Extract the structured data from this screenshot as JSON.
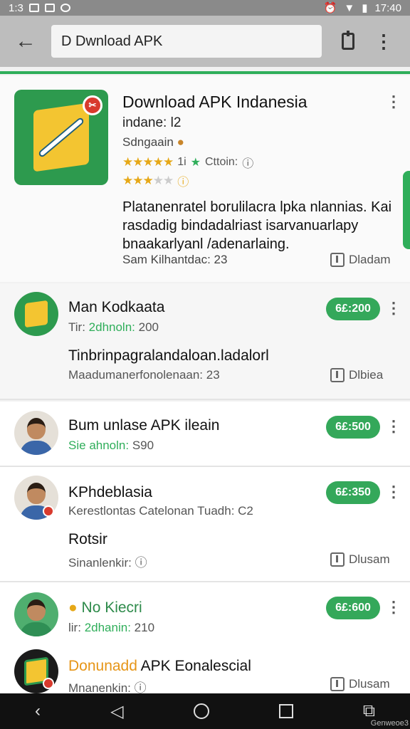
{
  "status_bar": {
    "time_left": "1:3",
    "time_right": "17:40"
  },
  "search": {
    "value": "D Dwnload APK"
  },
  "main_card": {
    "title": "Download APK Indanesia",
    "subtitle": "indane: l2",
    "developer": "Sdngaain",
    "rating_note": "1i",
    "rating_label": "Cttoin:",
    "description": "Platanenratel borulilacra lpka nlannias. Kai rasdadig bindadalriast isarvanuarlapy bnaakarlyanl /adenarlaing.",
    "footer_meta": "Sam Kilhantdac: 23",
    "download_label": "Dladam"
  },
  "items": [
    {
      "title": "Man Kodkaata",
      "sub_prefix": "Tir:",
      "sub_green": "2dhnoln:",
      "sub_value": "200",
      "body": "Tinbrinpagralandaloan.ladalorl",
      "meta": "Maadumanerfonolenaan: 23",
      "pill": "6£:200",
      "download_label": "Dlbiea"
    },
    {
      "title": "Bum unlase APK ileain",
      "sub_prefix": "Sie",
      "sub_green": "ahnoln:",
      "sub_value": "S90",
      "pill": "6£:500"
    },
    {
      "title": "KPhdeblasia",
      "sub_full": "Kerestlontas Catelonan Tuadh: C2",
      "body": "Rotsir",
      "meta": "Sinanlenkir:",
      "pill": "6£:350",
      "download_label": "Dlusam"
    },
    {
      "title": "No Kiecri",
      "sub_prefix": "lir:",
      "sub_green": "2dhanin:",
      "sub_value": "210",
      "pill": "6£:600"
    },
    {
      "title_orange": "Donunadd",
      "title_rest": "APK Eonalescial",
      "meta": "Mnanenkin:",
      "download_label": "Dlusam"
    }
  ],
  "watermark": "Genweoe3",
  "colors": {
    "accent_green": "#34a85a",
    "toolbar_gray": "#bdbdbd",
    "star_gold": "#e6a817"
  },
  "icons": [
    "back-arrow-icon",
    "clipboard-icon",
    "more-vert-icon",
    "download-icon",
    "nav-back-icon",
    "nav-home-icon",
    "nav-recents-icon"
  ]
}
